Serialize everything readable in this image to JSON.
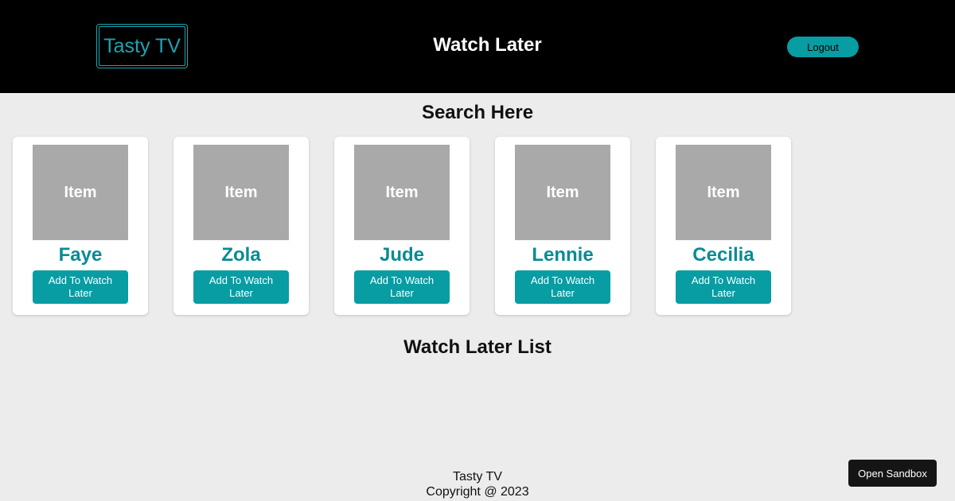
{
  "header": {
    "logo_text": "Tasty TV",
    "title": "Watch Later",
    "logout_label": "Logout"
  },
  "search": {
    "title": "Search Here"
  },
  "cards": [
    {
      "thumb_label": "Item",
      "name": "Faye",
      "button_label": "Add To Watch Later"
    },
    {
      "thumb_label": "Item",
      "name": "Zola",
      "button_label": "Add To Watch Later"
    },
    {
      "thumb_label": "Item",
      "name": "Jude",
      "button_label": "Add To Watch Later"
    },
    {
      "thumb_label": "Item",
      "name": "Lennie",
      "button_label": "Add To Watch Later"
    },
    {
      "thumb_label": "Item",
      "name": "Cecilia",
      "button_label": "Add To Watch Later"
    }
  ],
  "watch_later": {
    "title": "Watch Later List"
  },
  "footer": {
    "line1": "Tasty TV",
    "line2": "Copyright @ 2023"
  },
  "sandbox": {
    "label": "Open Sandbox"
  },
  "colors": {
    "accent": "#089ca3",
    "name_text": "#088b93",
    "header_bg": "#000000",
    "page_bg": "#ececec",
    "thumb_bg": "#a9a9a9"
  }
}
